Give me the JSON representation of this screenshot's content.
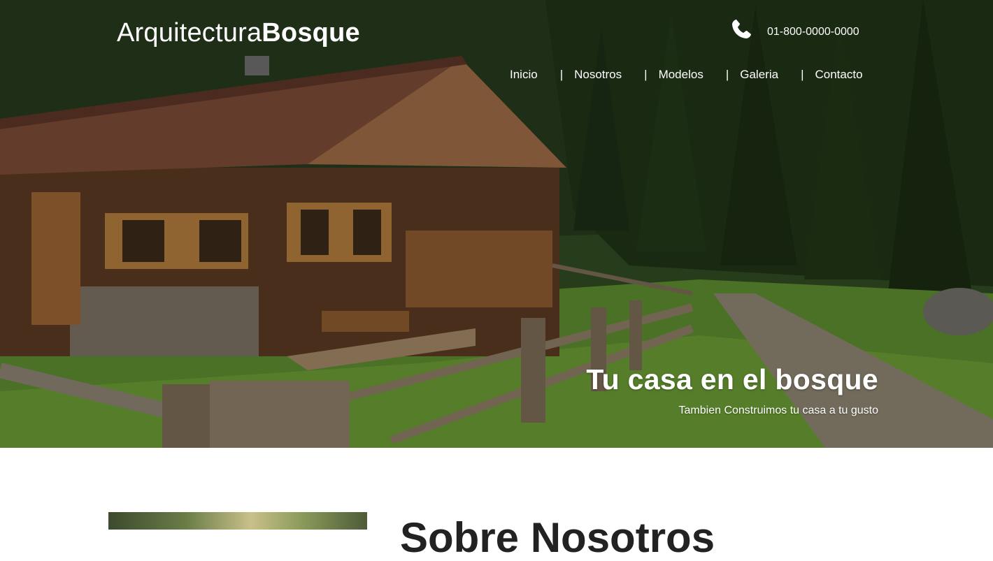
{
  "brand": {
    "name_light": "Arquitectura",
    "name_bold": "Bosque"
  },
  "contact": {
    "icon": "phone-icon",
    "phone": "01-800-0000-0000"
  },
  "nav": {
    "items": [
      {
        "label": "Inicio"
      },
      {
        "label": "Nosotros"
      },
      {
        "label": "Modelos"
      },
      {
        "label": "Galeria"
      },
      {
        "label": "Contacto"
      }
    ],
    "separator": "|"
  },
  "hero": {
    "title": "Tu casa en el bosque",
    "subtitle": "Tambien Construimos tu casa a tu gusto"
  },
  "section": {
    "title": "Sobre Nosotros"
  },
  "colors": {
    "text_on_hero": "#ffffff",
    "section_title": "#222222",
    "page_background": "#ffffff"
  }
}
